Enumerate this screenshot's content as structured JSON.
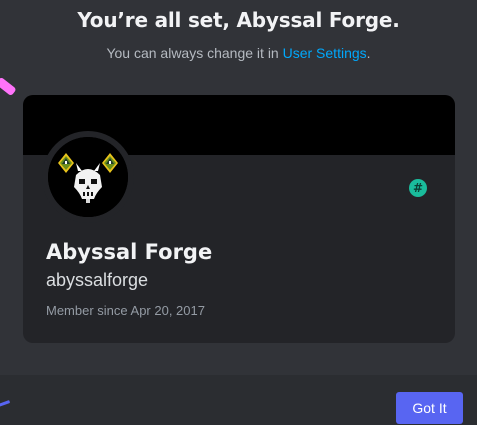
{
  "header": {
    "title": "You’re all set, Abyssal Forge.",
    "subtitle_prefix": "You can always change it in ",
    "subtitle_link": "User Settings",
    "subtitle_suffix": "."
  },
  "profile": {
    "display_name": "Abyssal Forge",
    "username": "abyssalforge",
    "member_since": "Member since Apr 20, 2017",
    "badge_icon": "hash-icon",
    "badge_glyph": "#",
    "badge_color": "#1abc9c",
    "banner_color": "#000000",
    "avatar_icon": "skull-with-lanterns-icon"
  },
  "footer": {
    "got_it_label": "Got It",
    "button_color": "#5865f2"
  },
  "colors": {
    "background": "#313338",
    "card": "#232428",
    "footer": "#2b2d31",
    "link": "#00a8fc"
  }
}
